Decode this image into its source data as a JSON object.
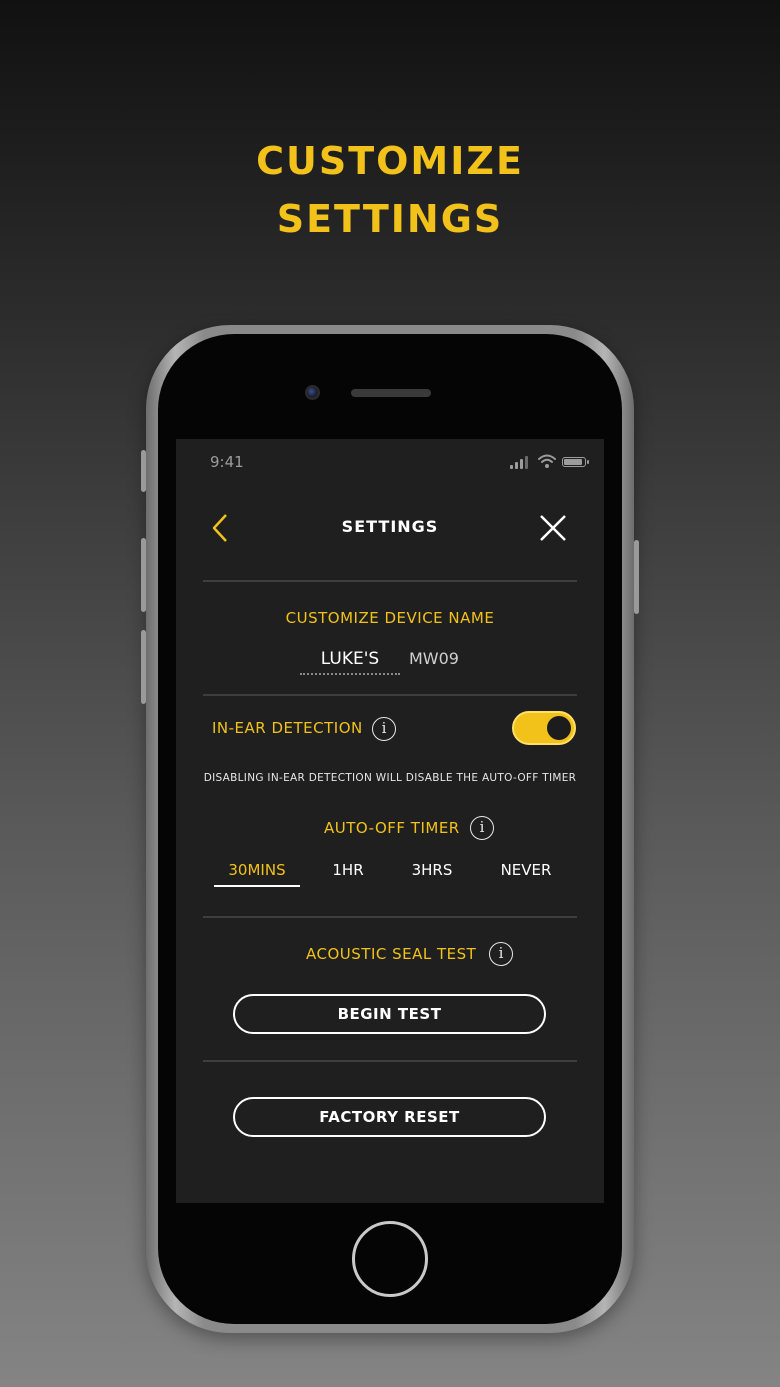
{
  "headline": {
    "line1": "CUSTOMIZE",
    "line2": "SETTINGS"
  },
  "colors": {
    "accent": "#f2c21b",
    "screen_bg": "#1f1f1f",
    "text": "#ffffff"
  },
  "status_bar": {
    "time": "9:41"
  },
  "nav": {
    "back_icon": "chevron-left-icon",
    "title": "SETTINGS",
    "close_icon": "close-icon"
  },
  "device_name": {
    "label": "CUSTOMIZE DEVICE NAME",
    "value": "LUKE'S",
    "suffix": "MW09"
  },
  "in_ear": {
    "label": "IN-EAR DETECTION",
    "info_glyph": "i",
    "toggle_on": true,
    "note": "DISABLING IN-EAR DETECTION WILL DISABLE THE AUTO-OFF TIMER"
  },
  "auto_off": {
    "label": "AUTO-OFF TIMER",
    "info_glyph": "i",
    "options": [
      "30MINS",
      "1HR",
      "3HRS",
      "NEVER"
    ],
    "selected": "30MINS"
  },
  "acoustic": {
    "label": "ACOUSTIC SEAL TEST",
    "info_glyph": "i",
    "button": "BEGIN TEST"
  },
  "reset": {
    "button": "FACTORY RESET"
  }
}
